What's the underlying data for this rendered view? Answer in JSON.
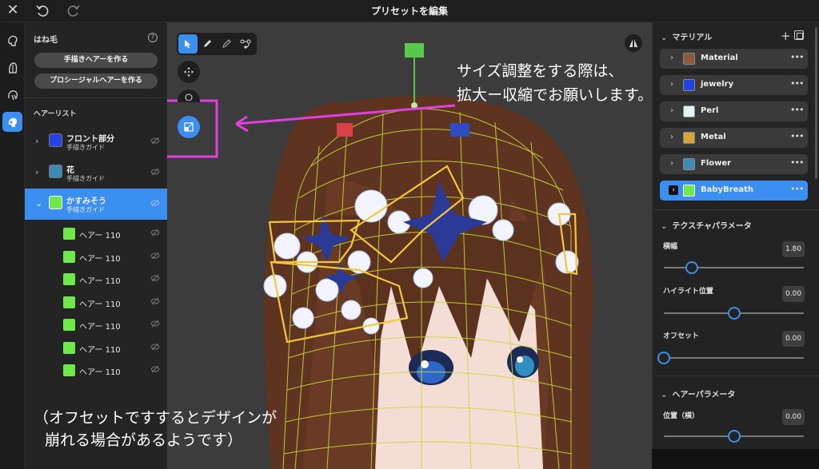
{
  "topbar": {
    "title": "プリセットを編集"
  },
  "left_panel": {
    "heading": "はね毛",
    "buttons": [
      "手描きヘアーを作る",
      "プロシージャルヘアーを作る"
    ],
    "list_title": "ヘアーリスト",
    "groups": [
      {
        "name": "フロント部分",
        "subtitle": "手描きガイド",
        "color": "#2243e6"
      },
      {
        "name": "花",
        "subtitle": "手描きガイド",
        "color": "#3d8ab5"
      },
      {
        "name": "かすみそう",
        "subtitle": "手描きガイド",
        "color": "#6ee84a"
      }
    ],
    "hair_items": [
      "ヘアー 110",
      "ヘアー 110",
      "ヘアー 110",
      "ヘアー 110",
      "ヘアー 110",
      "ヘアー 110",
      "ヘアー 110"
    ]
  },
  "viewport": {
    "note_top": [
      "サイズ調整をする際は、",
      "拡大ー収縮でお願いします。"
    ],
    "note_bottom": [
      "（オフセットですするとデザインが",
      "崩れる場合があるようです）"
    ],
    "annotation_color": "#e040e0"
  },
  "right_panel": {
    "materials_title": "マテリアル",
    "materials": [
      {
        "name": "Material",
        "color": "#8a5a3e"
      },
      {
        "name": "jewelry",
        "color": "#2143e0"
      },
      {
        "name": "Perl",
        "color": "#e4f4f6"
      },
      {
        "name": "Metal",
        "color": "#d9a635"
      },
      {
        "name": "Flower",
        "color": "#3d8ab5"
      },
      {
        "name": "BabyBreath",
        "color": "#6ee84a"
      }
    ],
    "texture_title": "テクスチャパラメータ",
    "texture_params": [
      {
        "label": "横幅",
        "value": "1.80",
        "fraction": 0.2
      },
      {
        "label": "ハイライト位置",
        "value": "0.00",
        "fraction": 0.5
      },
      {
        "label": "オフセット",
        "value": "0.00",
        "fraction": 0.0
      }
    ],
    "hair_title": "ヘアーパラメータ",
    "hair_params": [
      {
        "label": "位置（横）",
        "value": "0.00",
        "fraction": 0.5
      }
    ]
  }
}
